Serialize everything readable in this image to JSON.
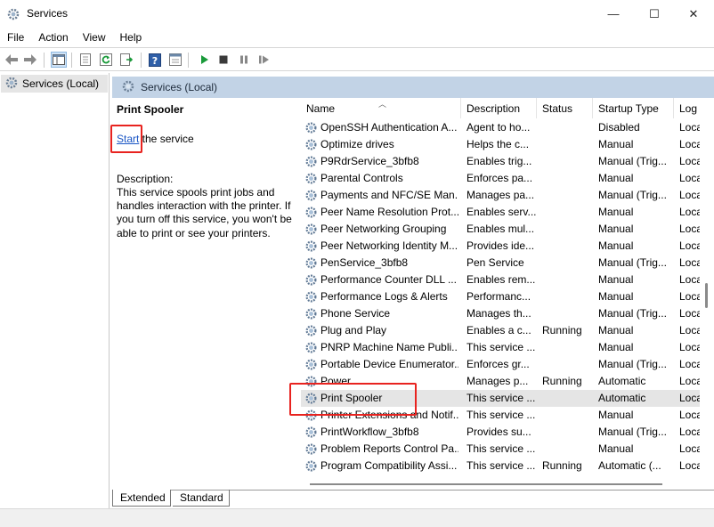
{
  "window": {
    "title": "Services",
    "minimize_glyph": "—",
    "maximize_glyph": "☐",
    "close_glyph": "✕"
  },
  "menu": [
    "File",
    "Action",
    "View",
    "Help"
  ],
  "toolbar": {
    "icons": [
      "back-icon",
      "forward-icon",
      "show-hide-console-tree-icon",
      "properties-icon",
      "refresh-icon",
      "export-list-icon",
      "help-icon",
      "view-icon",
      "start-service-icon",
      "stop-service-icon",
      "pause-service-icon",
      "restart-service-icon"
    ]
  },
  "tree": {
    "root_label": "Services (Local)"
  },
  "pane": {
    "header": "Services (Local)"
  },
  "description_panel": {
    "service_title": "Print Spooler",
    "start_link": "Start",
    "start_suffix": " the service",
    "description_label": "Description:",
    "description_text": "This service spools print jobs and handles interaction with the printer. If you turn off this service, you won't be able to print or see your printers."
  },
  "columns": {
    "name": "Name",
    "description": "Description",
    "status": "Status",
    "startup_type": "Startup Type",
    "log_on_as": "Log"
  },
  "services": [
    {
      "name": "OpenSSH Authentication A...",
      "description": "Agent to ho...",
      "status": "",
      "startup": "Disabled",
      "logon": "Loca"
    },
    {
      "name": "Optimize drives",
      "description": "Helps the c...",
      "status": "",
      "startup": "Manual",
      "logon": "Loca"
    },
    {
      "name": "P9RdrService_3bfb8",
      "description": "Enables trig...",
      "status": "",
      "startup": "Manual (Trig...",
      "logon": "Loca"
    },
    {
      "name": "Parental Controls",
      "description": "Enforces pa...",
      "status": "",
      "startup": "Manual",
      "logon": "Loca"
    },
    {
      "name": "Payments and NFC/SE Man...",
      "description": "Manages pa...",
      "status": "",
      "startup": "Manual (Trig...",
      "logon": "Loca"
    },
    {
      "name": "Peer Name Resolution Prot...",
      "description": "Enables serv...",
      "status": "",
      "startup": "Manual",
      "logon": "Loca"
    },
    {
      "name": "Peer Networking Grouping",
      "description": "Enables mul...",
      "status": "",
      "startup": "Manual",
      "logon": "Loca"
    },
    {
      "name": "Peer Networking Identity M...",
      "description": "Provides ide...",
      "status": "",
      "startup": "Manual",
      "logon": "Loca"
    },
    {
      "name": "PenService_3bfb8",
      "description": "Pen Service",
      "status": "",
      "startup": "Manual (Trig...",
      "logon": "Loca"
    },
    {
      "name": "Performance Counter DLL ...",
      "description": "Enables rem...",
      "status": "",
      "startup": "Manual",
      "logon": "Loca"
    },
    {
      "name": "Performance Logs & Alerts",
      "description": "Performanc...",
      "status": "",
      "startup": "Manual",
      "logon": "Loca"
    },
    {
      "name": "Phone Service",
      "description": "Manages th...",
      "status": "",
      "startup": "Manual (Trig...",
      "logon": "Loca"
    },
    {
      "name": "Plug and Play",
      "description": "Enables a c...",
      "status": "Running",
      "startup": "Manual",
      "logon": "Loca"
    },
    {
      "name": "PNRP Machine Name Publi...",
      "description": "This service ...",
      "status": "",
      "startup": "Manual",
      "logon": "Loca"
    },
    {
      "name": "Portable Device Enumerator...",
      "description": "Enforces gr...",
      "status": "",
      "startup": "Manual (Trig...",
      "logon": "Loca"
    },
    {
      "name": "Power",
      "description": "Manages p...",
      "status": "Running",
      "startup": "Automatic",
      "logon": "Loca"
    },
    {
      "name": "Print Spooler",
      "description": "This service ...",
      "status": "",
      "startup": "Automatic",
      "logon": "Loca",
      "selected": true
    },
    {
      "name": "Printer Extensions and Notif...",
      "description": "This service ...",
      "status": "",
      "startup": "Manual",
      "logon": "Loca"
    },
    {
      "name": "PrintWorkflow_3bfb8",
      "description": "Provides su...",
      "status": "",
      "startup": "Manual (Trig...",
      "logon": "Loca"
    },
    {
      "name": "Problem Reports Control Pa...",
      "description": "This service ...",
      "status": "",
      "startup": "Manual",
      "logon": "Loca"
    },
    {
      "name": "Program Compatibility Assi...",
      "description": "This service ...",
      "status": "Running",
      "startup": "Automatic (...",
      "logon": "Loca"
    }
  ],
  "tabs": [
    "Extended",
    "Standard"
  ],
  "colors": {
    "highlight_box": "#e8231f",
    "link": "#1a56c5",
    "pane_header": "#c2d3e6",
    "selected_row": "#e5e5e5",
    "start_green": "#1a9a3a"
  }
}
